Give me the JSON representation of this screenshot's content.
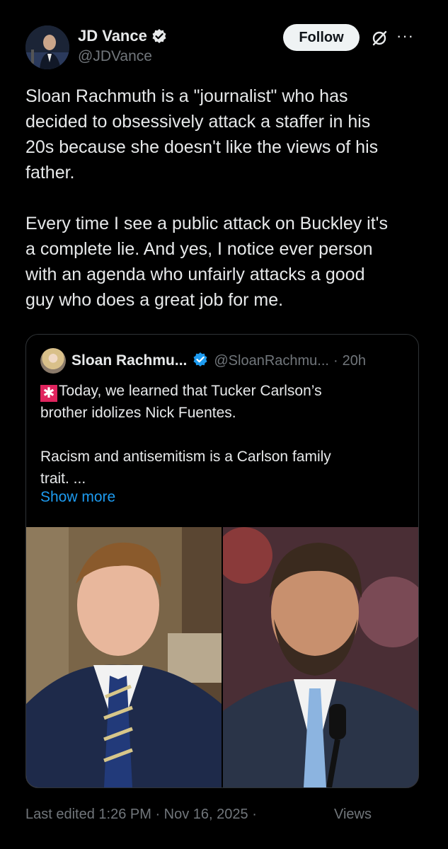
{
  "post": {
    "author": {
      "name": "JD Vance",
      "handle": "@JDVance"
    },
    "follow_label": "Follow",
    "more_label": "···",
    "text": "Sloan Rachmuth is a \"journalist\" who has\ndecided to obsessively attack a staffer in his\n20s because she doesn't like the views of his\nfather.\n\nEvery time I see a public attack on Buckley it's\na complete lie. And yes, I notice ever person\nwith an agenda who unfairly attacks a good\nguy who does a great job for me."
  },
  "quote": {
    "name": "Sloan Rachmu...",
    "handle": "@SloanRachmu...",
    "separator": "·",
    "time": "20h",
    "text": "Today, we learned that Tucker Carlson’s\nbrother idolizes Nick Fuentes.\n\nRacism and antisemitism is a Carlson family\ntrait. ...",
    "show_more": "Show more"
  },
  "footer": {
    "meta": "Last edited 1:26 PM · Nov 16, 2025 ·",
    "views": "Views"
  },
  "colors": {
    "background": "#000000",
    "text": "#e7e9ea",
    "secondary": "#71767b",
    "link": "#1d9bf0",
    "verified": "#1d9bf0"
  }
}
